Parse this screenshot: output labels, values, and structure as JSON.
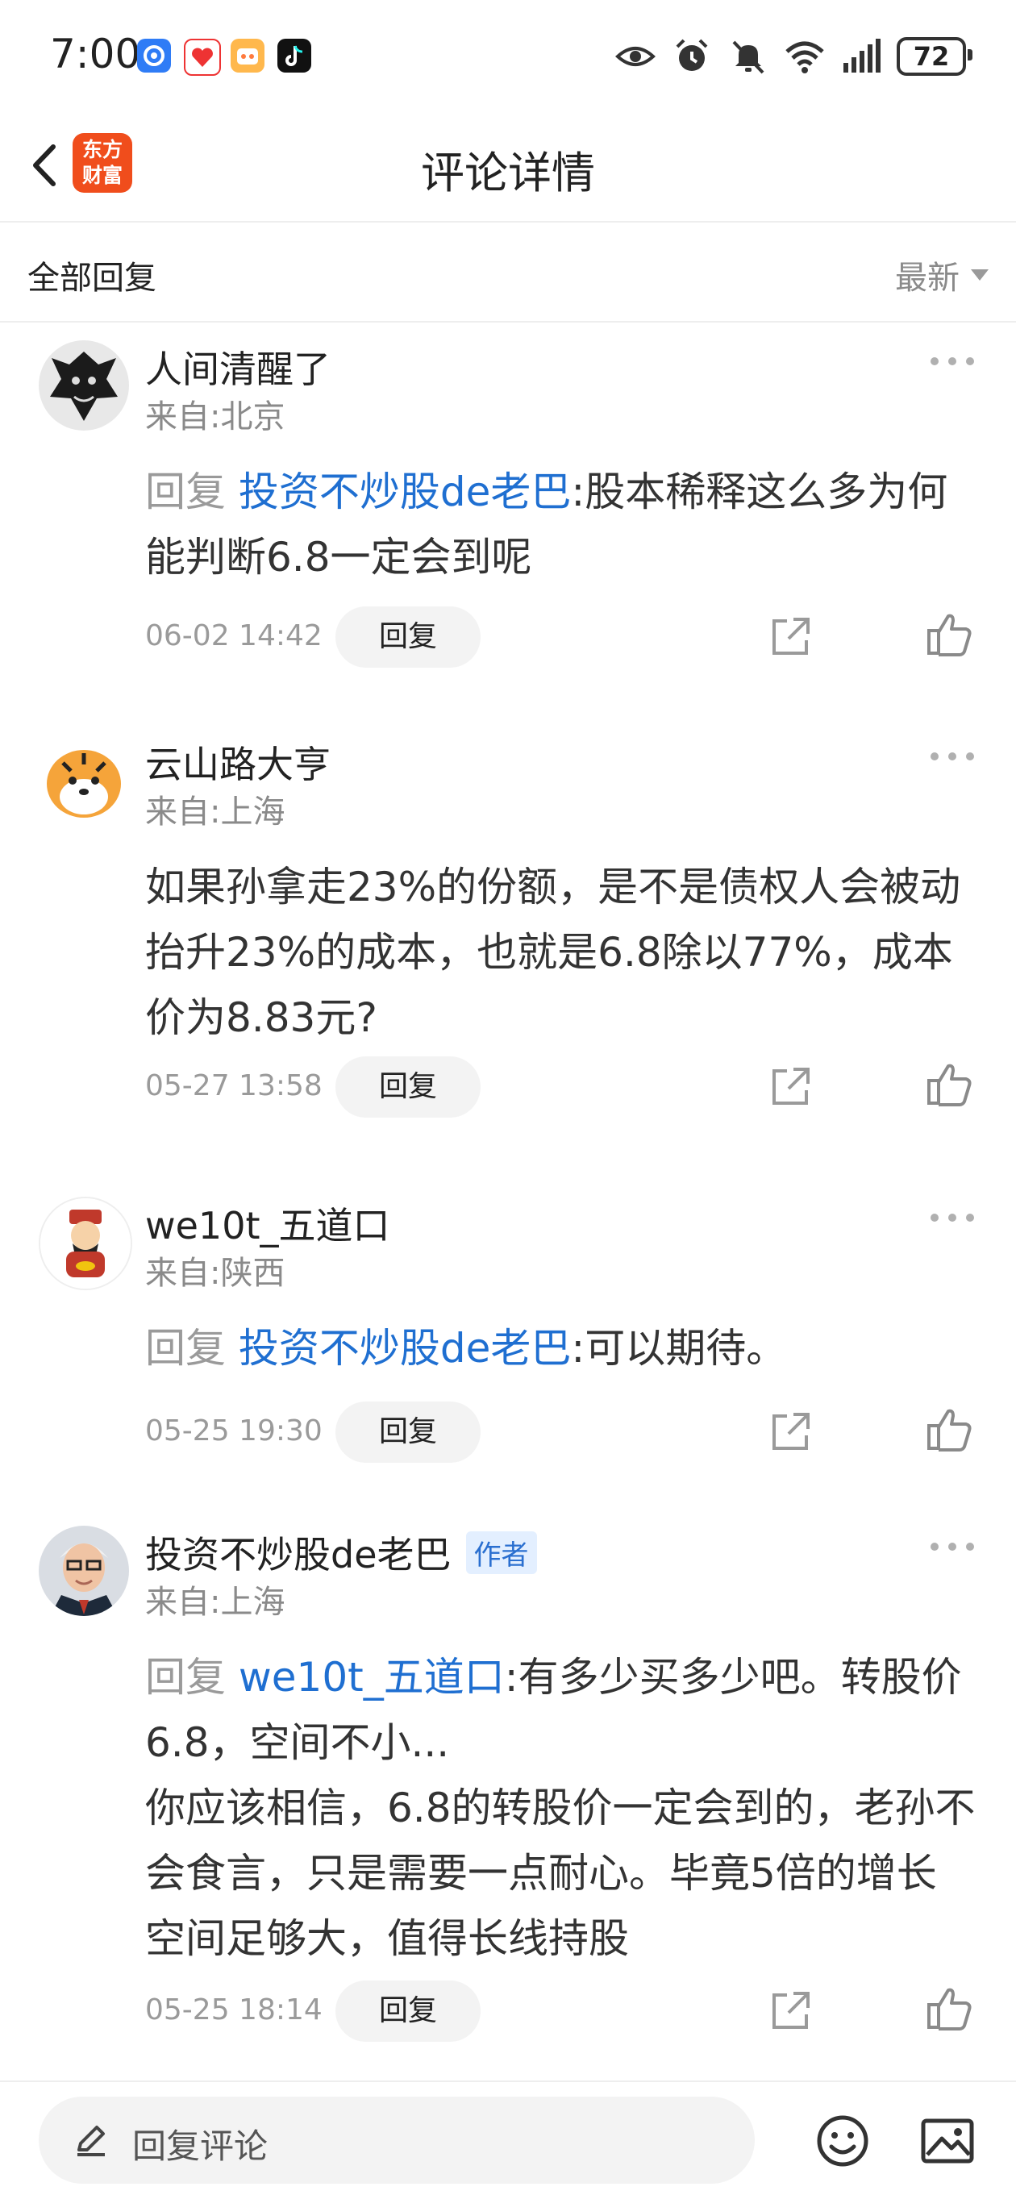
{
  "status_bar": {
    "time": "7:00",
    "battery": "72",
    "app_icons": [
      "location-app-icon",
      "xiaohongshu-app-icon",
      "bilibili-app-icon",
      "douyin-app-icon"
    ],
    "icons": [
      "eye-icon",
      "alarm-icon",
      "mute-icon",
      "wifi-icon",
      "signal-icon",
      "battery-icon"
    ]
  },
  "header": {
    "logo_line1": "东方",
    "logo_line2": "财富",
    "title": "评论详情"
  },
  "sort_bar": {
    "label": "全部回复",
    "sort_value": "最新"
  },
  "comments": [
    {
      "username": "人间清醒了",
      "location": "来自:北京",
      "reply_prefix": "回复 ",
      "reply_target": "投资不炒股de老巴",
      "text": ":股本稀释这么多为何能判断6.8一定会到呢",
      "date": "06-02 14:42",
      "reply_label": "回复",
      "is_author": false,
      "avatar": "dragon-avatar"
    },
    {
      "username": "云山路大亨",
      "location": "来自:上海",
      "reply_prefix": "",
      "reply_target": "",
      "text": "如果孙拿走23%的份额，是不是债权人会被动抬升23%的成本，也就是6.8除以77%，成本价为8.83元?",
      "date": "05-27 13:58",
      "reply_label": "回复",
      "is_author": false,
      "avatar": "tiger-avatar"
    },
    {
      "username": "we10t_五道口",
      "location": "来自:陕西",
      "reply_prefix": "回复 ",
      "reply_target": "投资不炒股de老巴",
      "text": ":可以期待。",
      "date": "05-25 19:30",
      "reply_label": "回复",
      "is_author": false,
      "avatar": "fortune-god-avatar"
    },
    {
      "username": "投资不炒股de老巴",
      "author_badge": "作者",
      "location": "来自:上海",
      "reply_prefix": "回复 ",
      "reply_target": "we10t_五道口",
      "text": ":有多少买多少吧。转股价6.8，空间不小...\n你应该相信，6.8的转股价一定会到的，老孙不会食言，只是需要一点耐心。毕竟5倍的增长空间足够大，值得长线持股",
      "date": "05-25 18:14",
      "reply_label": "回复",
      "is_author": true,
      "avatar": "old-man-avatar"
    }
  ],
  "bottom_bar": {
    "input_placeholder": "回复评论",
    "icons": [
      "edit-icon",
      "emoji-icon",
      "image-icon"
    ]
  },
  "colors": {
    "link_blue": "#1f6fd1",
    "brand_orange": "#f04d1c",
    "muted_gray": "#9a9a9a"
  }
}
